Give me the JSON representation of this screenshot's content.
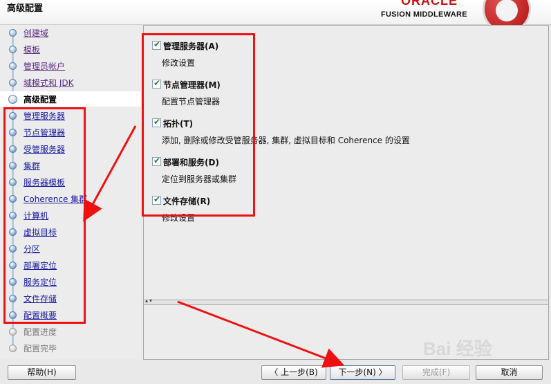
{
  "header": {
    "title": "高级配置",
    "logo_word": "ORACLE",
    "logo_subtitle": "FUSION MIDDLEWARE"
  },
  "nav": {
    "items": [
      {
        "label": "创建域",
        "state": "done"
      },
      {
        "label": "模板",
        "state": "done"
      },
      {
        "label": "管理员帐户",
        "state": "done"
      },
      {
        "label": "域模式和 JDK",
        "state": "done"
      },
      {
        "label": "高级配置",
        "state": "current"
      },
      {
        "label": "管理服务器",
        "state": "pending"
      },
      {
        "label": "节点管理器",
        "state": "pending"
      },
      {
        "label": "受管服务器",
        "state": "pending"
      },
      {
        "label": "集群",
        "state": "pending"
      },
      {
        "label": "服务器模板",
        "state": "pending"
      },
      {
        "label": "Coherence 集群",
        "state": "pending"
      },
      {
        "label": "计算机",
        "state": "pending"
      },
      {
        "label": "虚拟目标",
        "state": "pending"
      },
      {
        "label": "分区",
        "state": "pending"
      },
      {
        "label": "部署定位",
        "state": "pending"
      },
      {
        "label": "服务定位",
        "state": "pending"
      },
      {
        "label": "文件存储",
        "state": "pending"
      },
      {
        "label": "配置概要",
        "state": "pending"
      },
      {
        "label": "配置进度",
        "state": "disabled"
      },
      {
        "label": "配置完毕",
        "state": "disabled"
      }
    ]
  },
  "options": [
    {
      "title": "管理服务器(A)",
      "desc": "修改设置",
      "checked": true
    },
    {
      "title": "节点管理器(M)",
      "desc": "配置节点管理器",
      "checked": true
    },
    {
      "title": "拓扑(T)",
      "desc": "添加, 删除或修改受管服务器, 集群, 虚拟目标和 Coherence 的设置",
      "checked": true
    },
    {
      "title": "部署和服务(D)",
      "desc": "定位到服务器或集群",
      "checked": true
    },
    {
      "title": "文件存储(R)",
      "desc": "修改设置",
      "checked": true
    }
  ],
  "buttons": {
    "help": "帮助(H)",
    "back": "〈 上一步(B)",
    "next": "下一步(N) 〉",
    "finish": "完成(F)",
    "cancel": "取消"
  },
  "watermark": "Bai 经验",
  "colors": {
    "annotation_red": "#ee1111",
    "link_blue": "#1a1aa0",
    "oracle_red": "#cc1010"
  }
}
